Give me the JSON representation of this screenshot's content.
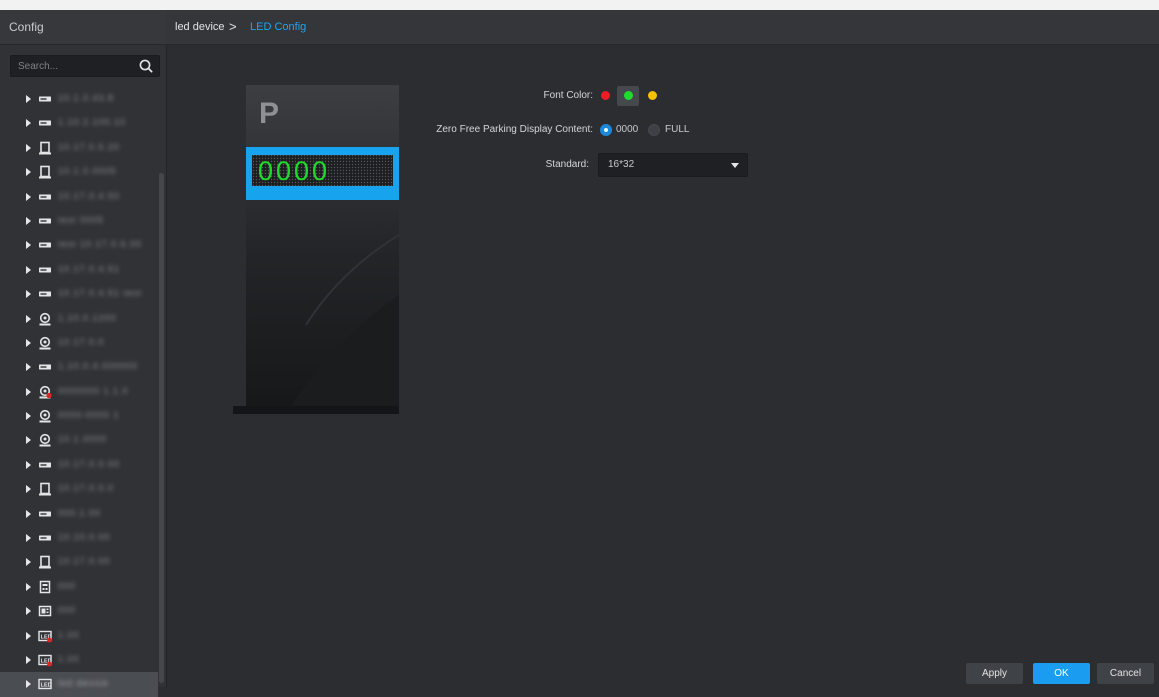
{
  "sidebar": {
    "title": "Config",
    "search": {
      "placeholder": "Search..."
    },
    "tree": [
      {
        "icon": "nvr-device-icon",
        "label": "10.1.0.43.8"
      },
      {
        "icon": "nvr-device-icon",
        "label": "1.10.2.100.10"
      },
      {
        "icon": "access-controller-icon",
        "label": "10.17.0.5.20"
      },
      {
        "icon": "access-controller-icon",
        "label": "10.1.0.0005"
      },
      {
        "icon": "nvr-device-icon",
        "label": "10.17.0.4.50"
      },
      {
        "icon": "nvr-device-icon",
        "label": "test 0005"
      },
      {
        "icon": "nvr-device-icon",
        "label": "test 10.17.0.6.00"
      },
      {
        "icon": "nvr-device-icon",
        "label": "10.17.0.4.51"
      },
      {
        "icon": "nvr-device-icon",
        "label": "10.17.0.4.51 test"
      },
      {
        "icon": "camera-icon",
        "label": "1.10.0.1200"
      },
      {
        "icon": "camera-icon",
        "label": "10.17.0.0"
      },
      {
        "icon": "nvr-device-icon",
        "label": "1.10.0.4.000000"
      },
      {
        "icon": "camera-offline-icon",
        "label": "0000000 1.1.0"
      },
      {
        "icon": "camera-icon",
        "label": "0000-0000 1"
      },
      {
        "icon": "camera-icon",
        "label": "10.1.0000"
      },
      {
        "icon": "nvr-device-icon",
        "label": "10.17.0.0.00"
      },
      {
        "icon": "access-controller-icon",
        "label": "10.17.0.0.0"
      },
      {
        "icon": "nvr-device-icon",
        "label": "000.1.00"
      },
      {
        "icon": "nvr-device-icon",
        "label": "10.10.0.00"
      },
      {
        "icon": "access-controller-icon",
        "label": "10.17.0.00"
      },
      {
        "icon": "door-station-icon",
        "label": "000"
      },
      {
        "icon": "intercom-icon",
        "label": "000"
      },
      {
        "icon": "led-offline-icon",
        "label": "1.00"
      },
      {
        "icon": "led-offline-icon",
        "label": "1.00"
      },
      {
        "icon": "led-device-icon",
        "label": "led device",
        "selected": true
      }
    ]
  },
  "breadcrumb": {
    "parent": "led device",
    "separator": ">",
    "current": "LED Config"
  },
  "preview": {
    "sign_letter": "P",
    "display_text": "0000"
  },
  "form": {
    "font_color": {
      "label": "Font Color:",
      "options": [
        {
          "name": "red",
          "color": "#ee1c24"
        },
        {
          "name": "green",
          "color": "#1edb2c",
          "selected": true
        },
        {
          "name": "yellow",
          "color": "#f5c200"
        }
      ]
    },
    "zero_free": {
      "label": "Zero Free Parking Display Content:",
      "options": [
        {
          "label": "0000",
          "checked": true
        },
        {
          "label": "FULL",
          "checked": false
        }
      ]
    },
    "standard": {
      "label": "Standard:",
      "value": "16*32"
    }
  },
  "buttons": {
    "apply": "Apply",
    "ok": "OK",
    "cancel": "Cancel"
  },
  "colors": {
    "accent": "#1a9cf0",
    "led_green": "#1edb2c",
    "sign_frame": "#18a3ef"
  }
}
